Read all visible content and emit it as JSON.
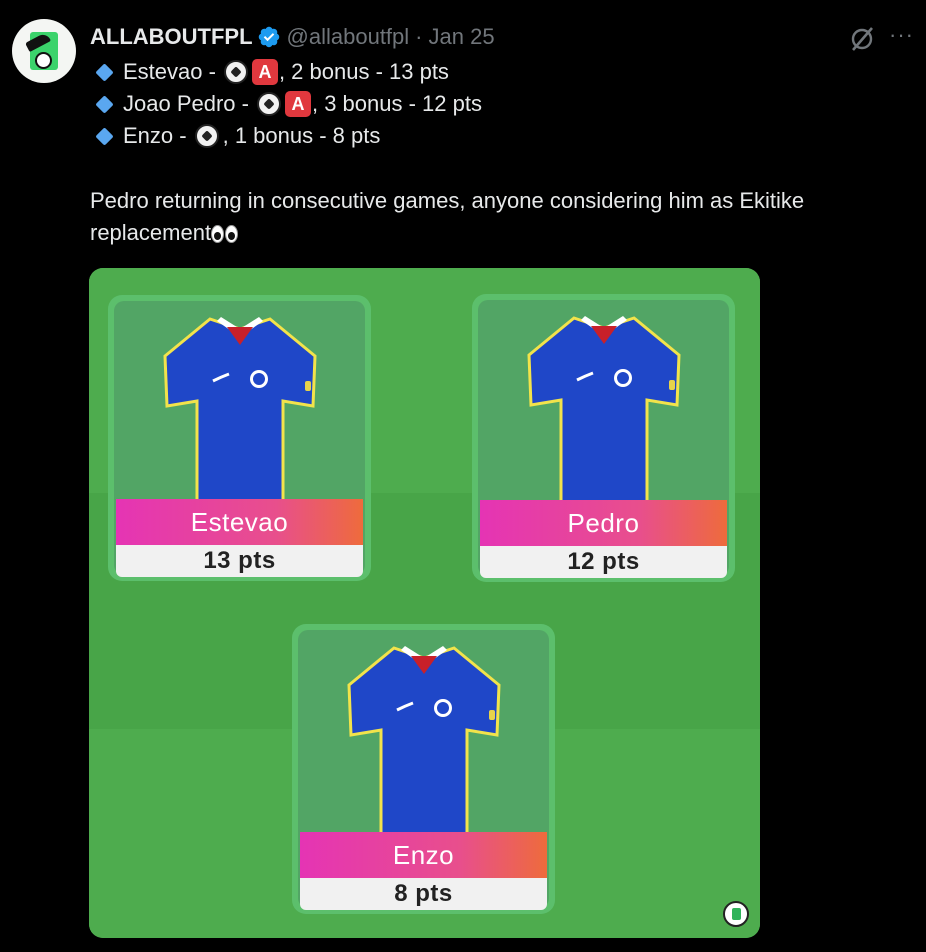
{
  "tweet": {
    "display_name": "ALLABOUTFPL",
    "handle": "@allaboutfpl",
    "separator": "·",
    "date": "Jan 25",
    "more_label": "···",
    "lines": [
      {
        "player": "Estevao -",
        "assist_badge": "A",
        "rest": ", 2 bonus - 13 pts"
      },
      {
        "player": "Joao Pedro -",
        "assist_badge": "A",
        "rest": ", 3 bonus - 12 pts"
      },
      {
        "player": "Enzo -",
        "rest": ", 1 bonus - 8 pts"
      }
    ],
    "body": "Pedro returning in consecutive games, anyone considering him as Ekitike replacement"
  },
  "media": {
    "cards": [
      {
        "name": "Estevao",
        "points": "13 pts"
      },
      {
        "name": "Pedro",
        "points": "12 pts"
      },
      {
        "name": "Enzo",
        "points": "8 pts"
      }
    ]
  },
  "colors": {
    "background": "#000000",
    "pitch_light": "#4eac4e",
    "pitch_dark": "#47a047",
    "shirt_blue": "#1f47c8",
    "name_gradient_start": "#e534b4",
    "name_gradient_end": "#ee6b3c",
    "verified_blue": "#1d9bf0"
  },
  "icons": {
    "verified": "verified-badge-icon",
    "grok": "grok-icon",
    "bullet": "blue-diamond-icon",
    "goal": "soccer-ball-icon",
    "assist": "a-button-icon",
    "eyes": "eyes-icon"
  }
}
